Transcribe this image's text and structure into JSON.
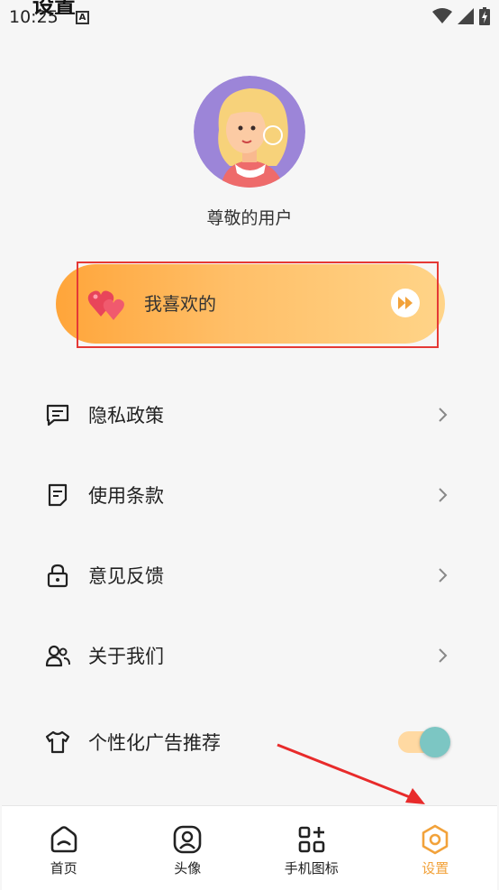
{
  "status_bar": {
    "time": "10:25",
    "notification_icon": "a-badge-icon",
    "icons": [
      "wifi-icon",
      "signal-icon",
      "battery-charging-icon"
    ]
  },
  "page": {
    "title": "设置"
  },
  "profile": {
    "name": "尊敬的用户",
    "avatar_icon": "user-avatar-illustration"
  },
  "favorites": {
    "label": "我喜欢的",
    "icon": "hearts-icon",
    "action_icon": "play-forward-icon"
  },
  "menu": [
    {
      "label": "隐私政策",
      "icon": "message-square-icon"
    },
    {
      "label": "使用条款",
      "icon": "document-icon"
    },
    {
      "label": "意见反馈",
      "icon": "lock-icon"
    },
    {
      "label": "关于我们",
      "icon": "users-icon"
    },
    {
      "label": "个性化广告推荐",
      "icon": "tshirt-icon",
      "toggle_on": true
    }
  ],
  "bottom_nav": [
    {
      "label": "首页",
      "icon": "home-icon",
      "active": false
    },
    {
      "label": "头像",
      "icon": "portrait-icon",
      "active": false
    },
    {
      "label": "手机图标",
      "icon": "grid-plus-icon",
      "active": false
    },
    {
      "label": "设置",
      "icon": "hexagon-settings-icon",
      "active": true
    }
  ],
  "colors": {
    "accent": "#f2a23a",
    "card_gradient_start": "#ffa53a",
    "card_gradient_end": "#ffd488",
    "toggle_knob": "#7cc6c3",
    "toggle_track": "#ffd9a2",
    "highlight": "#e53935"
  }
}
